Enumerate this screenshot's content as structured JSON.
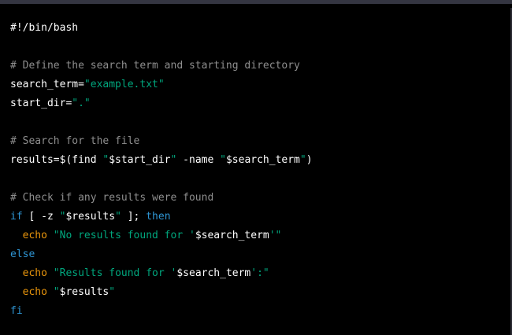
{
  "colors": {
    "background": "#000000",
    "default": "#ffffff",
    "comment": "#8e8e8e",
    "string": "#00a67d",
    "variable": "#df3079",
    "keyword": "#2e95d3",
    "builtin": "#e9950c"
  },
  "code": {
    "language": "bash",
    "lines": [
      [
        {
          "t": "default",
          "v": "#!/bin/bash"
        }
      ],
      [],
      [
        {
          "t": "comment",
          "v": "# Define the search term and starting directory"
        }
      ],
      [
        {
          "t": "default",
          "v": "search_term="
        },
        {
          "t": "string",
          "v": "\"example.txt\""
        }
      ],
      [
        {
          "t": "default",
          "v": "start_dir="
        },
        {
          "t": "string",
          "v": "\".\""
        }
      ],
      [],
      [
        {
          "t": "comment",
          "v": "# Search for the file"
        }
      ],
      [
        {
          "t": "default",
          "v": "results=$(find "
        },
        {
          "t": "string",
          "v": "\""
        },
        {
          "t": "variable",
          "v": "$start_dir"
        },
        {
          "t": "string",
          "v": "\""
        },
        {
          "t": "default",
          "v": " -name "
        },
        {
          "t": "string",
          "v": "\""
        },
        {
          "t": "variable",
          "v": "$search_term"
        },
        {
          "t": "string",
          "v": "\""
        },
        {
          "t": "default",
          "v": ")"
        }
      ],
      [],
      [
        {
          "t": "comment",
          "v": "# Check if any results were found"
        }
      ],
      [
        {
          "t": "keyword",
          "v": "if"
        },
        {
          "t": "default",
          "v": " [ -z "
        },
        {
          "t": "string",
          "v": "\""
        },
        {
          "t": "variable",
          "v": "$results"
        },
        {
          "t": "string",
          "v": "\""
        },
        {
          "t": "default",
          "v": " ]; "
        },
        {
          "t": "keyword",
          "v": "then"
        }
      ],
      [
        {
          "t": "default",
          "v": "  "
        },
        {
          "t": "builtin",
          "v": "echo"
        },
        {
          "t": "default",
          "v": " "
        },
        {
          "t": "string",
          "v": "\"No results found for '"
        },
        {
          "t": "variable",
          "v": "$search_term"
        },
        {
          "t": "string",
          "v": "'\""
        }
      ],
      [
        {
          "t": "keyword",
          "v": "else"
        }
      ],
      [
        {
          "t": "default",
          "v": "  "
        },
        {
          "t": "builtin",
          "v": "echo"
        },
        {
          "t": "default",
          "v": " "
        },
        {
          "t": "string",
          "v": "\"Results found for '"
        },
        {
          "t": "variable",
          "v": "$search_term"
        },
        {
          "t": "string",
          "v": "':\""
        }
      ],
      [
        {
          "t": "default",
          "v": "  "
        },
        {
          "t": "builtin",
          "v": "echo"
        },
        {
          "t": "default",
          "v": " "
        },
        {
          "t": "string",
          "v": "\""
        },
        {
          "t": "variable",
          "v": "$results"
        },
        {
          "t": "string",
          "v": "\""
        }
      ],
      [
        {
          "t": "keyword",
          "v": "fi"
        }
      ]
    ]
  }
}
